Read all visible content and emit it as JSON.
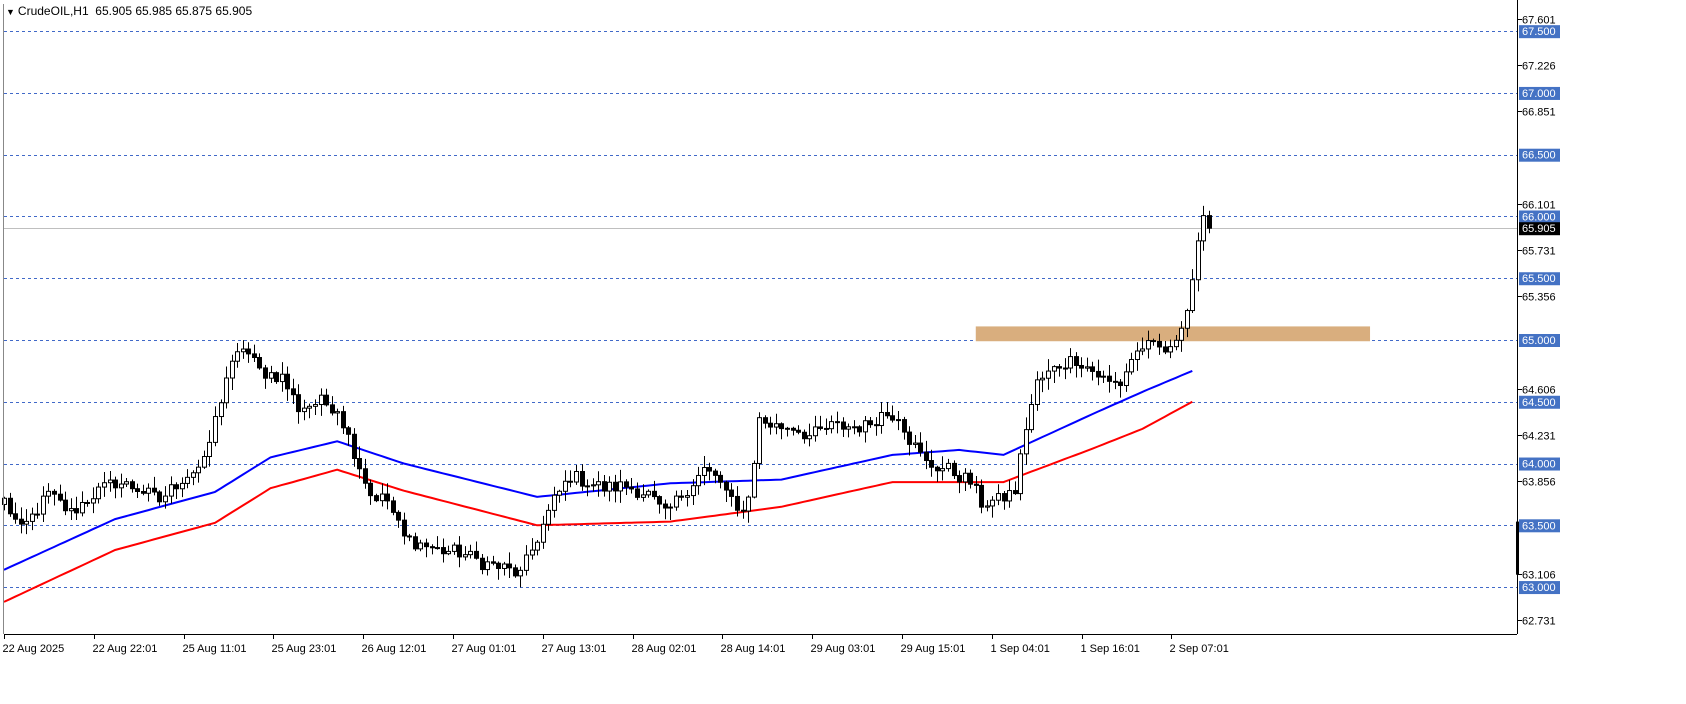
{
  "header": {
    "symbol_label": "CrudeOIL,H1",
    "ohlc": "65.905 65.985 65.875 65.905"
  },
  "chart_data": {
    "type": "candlestick",
    "y_range": [
      62.62,
      67.72
    ],
    "price_ticks": [
      "67.601",
      "67.226",
      "66.851",
      "66.101",
      "65.731",
      "65.356",
      "64.606",
      "64.231",
      "63.856",
      "63.106",
      "62.731"
    ],
    "level_lines": [
      {
        "value": 67.5,
        "label": "67.500"
      },
      {
        "value": 67.0,
        "label": "67.000"
      },
      {
        "value": 66.5,
        "label": "66.500"
      },
      {
        "value": 66.0,
        "label": "66.000"
      },
      {
        "value": 65.5,
        "label": "65.500"
      },
      {
        "value": 65.0,
        "label": "65.000"
      },
      {
        "value": 64.5,
        "label": "64.500"
      },
      {
        "value": 64.0,
        "label": "64.000"
      },
      {
        "value": 63.5,
        "label": "63.500"
      },
      {
        "value": 63.0,
        "label": "63.000"
      }
    ],
    "current_price": {
      "value": 65.905,
      "label": "65.905"
    },
    "time_labels": [
      "22 Aug 2025",
      "22 Aug 22:01",
      "25 Aug 11:01",
      "25 Aug 23:01",
      "26 Aug 12:01",
      "27 Aug 01:01",
      "27 Aug 13:01",
      "28 Aug 02:01",
      "28 Aug 14:01",
      "29 Aug 03:01",
      "29 Aug 15:01",
      "1 Sep 04:01",
      "1 Sep 16:01",
      "2 Sep 07:01"
    ],
    "zone": {
      "low": 64.99,
      "high": 65.11,
      "start_index": 175,
      "end_index": 246,
      "color": "#d9ae7e"
    },
    "colors": {
      "fast_ma": "#0000ff",
      "slow_ma": "#ff0000",
      "level_line": "#4169c8",
      "level_label_bg": "#4472c4",
      "grid_line": "#bfbfbf"
    },
    "key_points": [
      [
        0,
        63.7
      ],
      [
        3,
        63.45
      ],
      [
        8,
        63.75
      ],
      [
        12,
        63.6
      ],
      [
        16,
        63.75
      ],
      [
        20,
        63.85
      ],
      [
        24,
        63.8
      ],
      [
        28,
        63.7
      ],
      [
        32,
        63.88
      ],
      [
        36,
        64.0
      ],
      [
        40,
        64.7
      ],
      [
        43,
        64.95
      ],
      [
        46,
        64.75
      ],
      [
        50,
        64.7
      ],
      [
        53,
        64.45
      ],
      [
        57,
        64.5
      ],
      [
        60,
        64.45
      ],
      [
        63,
        64.1
      ],
      [
        66,
        63.75
      ],
      [
        69,
        63.7
      ],
      [
        72,
        63.4
      ],
      [
        75,
        63.35
      ],
      [
        78,
        63.3
      ],
      [
        82,
        63.28
      ],
      [
        86,
        63.2
      ],
      [
        90,
        63.15
      ],
      [
        93,
        63.1
      ],
      [
        96,
        63.4
      ],
      [
        99,
        63.7
      ],
      [
        102,
        63.9
      ],
      [
        105,
        63.85
      ],
      [
        108,
        63.8
      ],
      [
        112,
        63.82
      ],
      [
        116,
        63.75
      ],
      [
        119,
        63.58
      ],
      [
        122,
        63.75
      ],
      [
        126,
        63.95
      ],
      [
        129,
        63.85
      ],
      [
        132,
        63.6
      ],
      [
        134,
        63.72
      ],
      [
        136,
        64.35
      ],
      [
        139,
        64.3
      ],
      [
        142,
        64.3
      ],
      [
        145,
        64.22
      ],
      [
        149,
        64.3
      ],
      [
        152,
        64.3
      ],
      [
        155,
        64.3
      ],
      [
        158,
        64.4
      ],
      [
        161,
        64.4
      ],
      [
        163,
        64.2
      ],
      [
        166,
        64.0
      ],
      [
        170,
        63.95
      ],
      [
        174,
        63.85
      ],
      [
        176,
        63.68
      ],
      [
        179,
        63.7
      ],
      [
        182,
        63.78
      ],
      [
        184,
        64.3
      ],
      [
        186,
        64.65
      ],
      [
        190,
        64.8
      ],
      [
        193,
        64.85
      ],
      [
        196,
        64.75
      ],
      [
        199,
        64.65
      ],
      [
        201,
        64.65
      ],
      [
        203,
        64.85
      ],
      [
        205,
        64.95
      ],
      [
        208,
        64.93
      ],
      [
        210,
        64.9
      ],
      [
        212,
        65.15
      ],
      [
        213,
        65.25
      ],
      [
        215,
        65.75
      ],
      [
        216,
        65.95
      ],
      [
        217,
        65.905
      ]
    ],
    "fast_ma_points": [
      [
        0,
        63.14
      ],
      [
        20,
        63.55
      ],
      [
        38,
        63.77
      ],
      [
        48,
        64.05
      ],
      [
        60,
        64.18
      ],
      [
        72,
        64.0
      ],
      [
        96,
        63.73
      ],
      [
        120,
        63.84
      ],
      [
        140,
        63.87
      ],
      [
        160,
        64.07
      ],
      [
        172,
        64.11
      ],
      [
        180,
        64.07
      ],
      [
        196,
        64.4
      ],
      [
        205,
        64.58
      ],
      [
        214,
        64.75
      ]
    ],
    "slow_ma_points": [
      [
        0,
        62.88
      ],
      [
        20,
        63.3
      ],
      [
        38,
        63.52
      ],
      [
        48,
        63.8
      ],
      [
        60,
        63.95
      ],
      [
        72,
        63.78
      ],
      [
        96,
        63.5
      ],
      [
        120,
        63.53
      ],
      [
        140,
        63.65
      ],
      [
        160,
        63.85
      ],
      [
        172,
        63.85
      ],
      [
        180,
        63.85
      ],
      [
        196,
        64.12
      ],
      [
        205,
        64.28
      ],
      [
        214,
        64.5
      ]
    ]
  }
}
